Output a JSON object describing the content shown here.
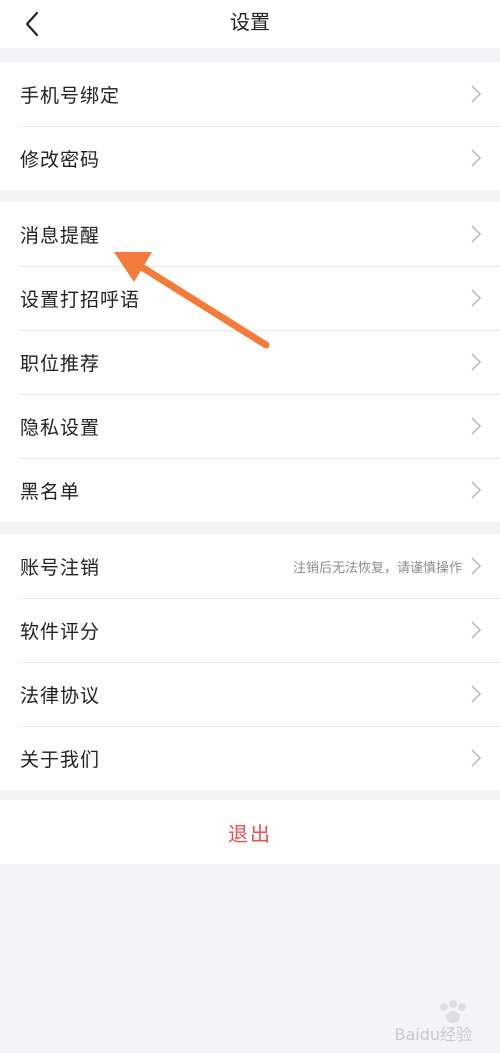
{
  "header": {
    "title": "设置",
    "back_icon": "chevron-left-icon"
  },
  "group1": {
    "items": [
      {
        "label": "手机号绑定"
      },
      {
        "label": "修改密码"
      }
    ]
  },
  "group2": {
    "items": [
      {
        "label": "消息提醒"
      },
      {
        "label": "设置打招呼语"
      },
      {
        "label": "职位推荐"
      },
      {
        "label": "隐私设置"
      },
      {
        "label": "黑名单"
      }
    ]
  },
  "group3": {
    "items": [
      {
        "label": "账号注销",
        "hint": "注销后无法恢复，请谨慎操作"
      },
      {
        "label": "软件评分"
      },
      {
        "label": "法律协议"
      },
      {
        "label": "关于我们"
      }
    ]
  },
  "logout": {
    "label": "退出",
    "color": "#ee4e4e"
  },
  "annotation": {
    "arrow_color": "#f47b3a"
  },
  "watermark": {
    "text": "Baidu经验"
  }
}
